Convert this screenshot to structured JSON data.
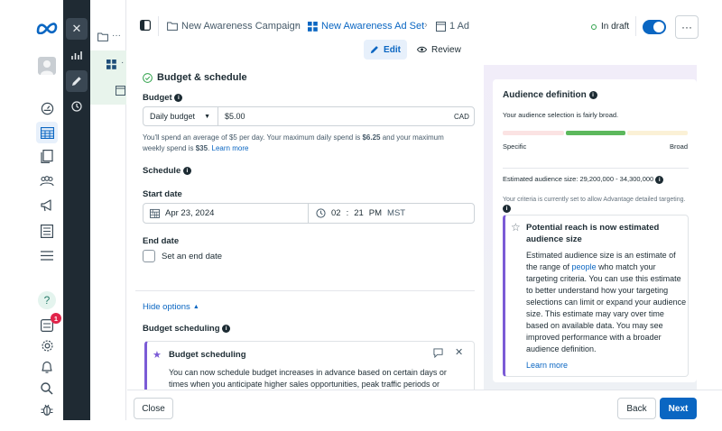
{
  "breadcrumbs": {
    "campaign": "New Awareness Campaign",
    "ad_set": "New Awareness Ad Set",
    "ad": "1 Ad"
  },
  "status": {
    "label": "In draft",
    "color": "#31a24c"
  },
  "tabs": {
    "edit": "Edit",
    "review": "Review"
  },
  "budget_schedule": {
    "title": "Budget & schedule",
    "budget_label": "Budget",
    "budget_type": "Daily budget",
    "budget_amount": "$5.00",
    "currency": "CAD",
    "helper_part1": "You'll spend an average of $5 per day. Your maximum daily spend is ",
    "max_daily": "$6.25",
    "helper_part2": " and your maximum weekly spend is ",
    "max_weekly": "$35",
    "helper_part3": ". ",
    "learn_more": "Learn more",
    "schedule_label": "Schedule",
    "start_date_label": "Start date",
    "start_date": "Apr 23, 2024",
    "start_hour": "02",
    "start_minute": "21",
    "start_ampm": "PM",
    "timezone": "MST",
    "end_date_label": "End date",
    "end_date_checkbox": "Set an end date",
    "hide_options": "Hide options",
    "budget_scheduling_label": "Budget scheduling",
    "scheduling_card_title": "Budget scheduling",
    "scheduling_card_text": "You can now schedule budget increases in advance based on certain days or times when you anticipate higher sales opportunities, peak traffic periods or"
  },
  "audience": {
    "title": "Audience definition",
    "subtitle": "Your audience selection is fairly broad.",
    "meter_left": "Specific",
    "meter_right": "Broad",
    "meter_level": 0.5,
    "estimated_size": "Estimated audience size: 29,200,000 - 34,300,000",
    "criteria_text": "Your criteria is currently set to allow Advantage detailed targeting.",
    "reach_title": "Potential reach is now estimated audience size",
    "reach_text_1": "Estimated audience size is an estimate of the range of ",
    "reach_link": "people",
    "reach_text_2": " who match your targeting criteria. You can use this estimate to better understand how your targeting selections can limit or expand your audience size. This estimate may vary over time based on available data. You may see improved performance with a broader audience definition.",
    "reach_learn_more": "Learn more"
  },
  "footer": {
    "close": "Close",
    "back": "Back",
    "next": "Next"
  },
  "colors": {
    "accent": "#0a66c2",
    "purple_accent": "#7b5bd6",
    "meter_green": "#5cb85c"
  }
}
